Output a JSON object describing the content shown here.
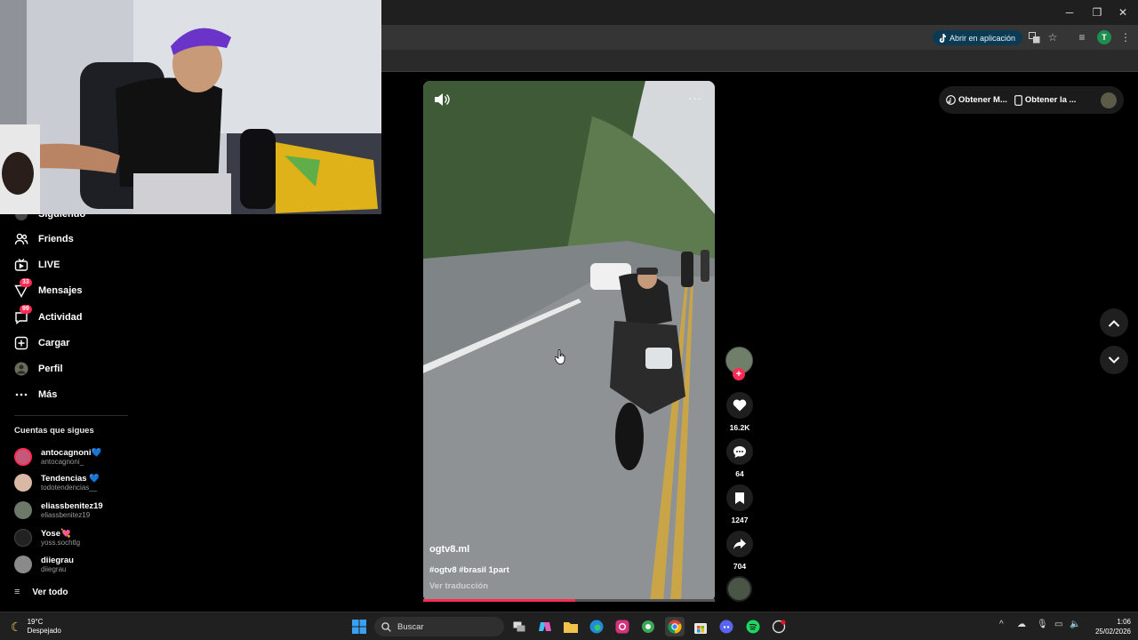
{
  "browser": {
    "open_app_label": "Abrir en aplicación",
    "profile_initial": "T"
  },
  "sidebar": {
    "items": [
      {
        "label": "Siguiendo",
        "icon": "following-icon"
      },
      {
        "label": "Friends",
        "icon": "friends-icon"
      },
      {
        "label": "LIVE",
        "icon": "live-icon"
      },
      {
        "label": "Mensajes",
        "icon": "messages-icon",
        "badge": "33"
      },
      {
        "label": "Actividad",
        "icon": "activity-icon",
        "badge": "99"
      },
      {
        "label": "Cargar",
        "icon": "upload-icon"
      },
      {
        "label": "Perfil",
        "icon": "profile-icon"
      },
      {
        "label": "Más",
        "icon": "more-icon"
      }
    ],
    "following_title": "Cuentas que sigues",
    "accounts": [
      {
        "name": "antocagnoni💙",
        "handle": "antocagnoni_",
        "color": "#c4587a"
      },
      {
        "name": "Tendencias 💙",
        "handle": "todotendencias__",
        "color": "#d9b9a6"
      },
      {
        "name": "eliassbenitez19",
        "handle": "eliassbenitez19",
        "color": "#6e7868"
      },
      {
        "name": "Yose💘",
        "handle": "yoss.sochtlg",
        "color": "#222222"
      },
      {
        "name": "diiegrau",
        "handle": "diiegrau",
        "color": "#8a8a8a"
      }
    ],
    "see_all": "Ver todo"
  },
  "video": {
    "author": "ogtv8.ml",
    "tags": "#ogtv8 #brasil  1part",
    "translate": "Ver traducción",
    "progress": 0.52
  },
  "actions": {
    "likes": "16.2K",
    "comments": "64",
    "saves": "1247",
    "shares": "704"
  },
  "top_pill": {
    "item1": "Obtener M...",
    "item2": "Obtener la ..."
  },
  "taskbar": {
    "weather_temp": "19°C",
    "weather_desc": "Despejado",
    "search_placeholder": "Buscar",
    "time": "1:06",
    "date": "25/02/2026"
  },
  "colors": {
    "accent": "#fe2c55",
    "background": "#000000",
    "open_app_bg": "#0b3a52"
  }
}
